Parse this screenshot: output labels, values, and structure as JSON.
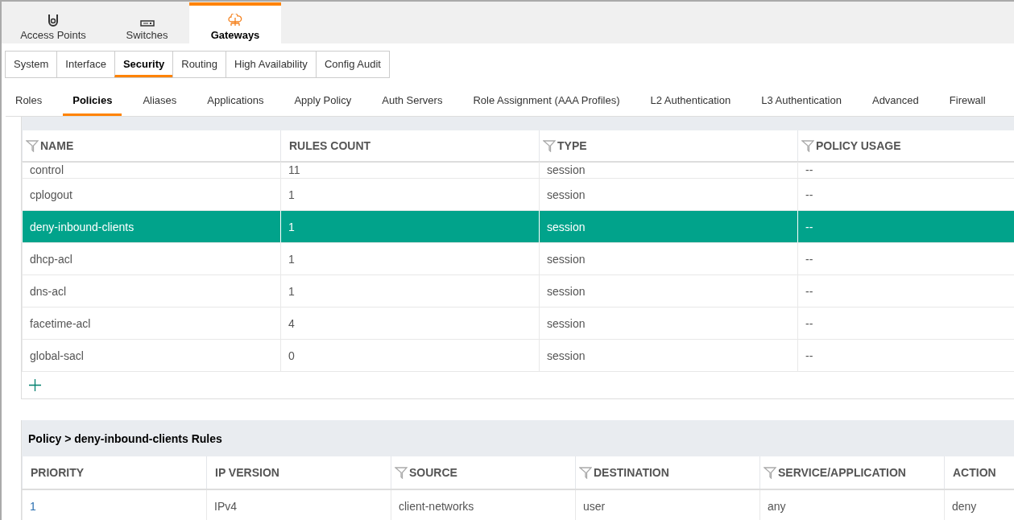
{
  "device_tabs": [
    {
      "label": "Access Points",
      "kind": "access-point",
      "selected": false
    },
    {
      "label": "Switches",
      "kind": "switch",
      "selected": false
    },
    {
      "label": "Gateways",
      "kind": "gateway",
      "selected": true
    }
  ],
  "section_tabs": [
    {
      "label": "System",
      "selected": false
    },
    {
      "label": "Interface",
      "selected": false
    },
    {
      "label": "Security",
      "selected": true
    },
    {
      "label": "Routing",
      "selected": false
    },
    {
      "label": "High Availability",
      "selected": false
    },
    {
      "label": "Config Audit",
      "selected": false
    }
  ],
  "security_tabs": [
    {
      "label": "Roles",
      "selected": false
    },
    {
      "label": "Policies",
      "selected": true
    },
    {
      "label": "Aliases",
      "selected": false
    },
    {
      "label": "Applications",
      "selected": false
    },
    {
      "label": "Apply Policy",
      "selected": false
    },
    {
      "label": "Auth Servers",
      "selected": false
    },
    {
      "label": "Role Assignment (AAA Profiles)",
      "selected": false
    },
    {
      "label": "L2 Authentication",
      "selected": false
    },
    {
      "label": "L3 Authentication",
      "selected": false
    },
    {
      "label": "Advanced",
      "selected": false
    },
    {
      "label": "Firewall",
      "selected": false
    }
  ],
  "policies_table": {
    "columns": [
      {
        "label": "NAME",
        "filter": true
      },
      {
        "label": "RULES COUNT",
        "filter": false
      },
      {
        "label": "TYPE",
        "filter": true
      },
      {
        "label": "POLICY USAGE",
        "filter": true
      }
    ],
    "rows": [
      {
        "cells": [
          "control",
          "11",
          "session",
          "--"
        ],
        "selected": false,
        "partial": true
      },
      {
        "cells": [
          "cplogout",
          "1",
          "session",
          "--"
        ],
        "selected": false,
        "partial": false
      },
      {
        "cells": [
          "deny-inbound-clients",
          "1",
          "session",
          "--"
        ],
        "selected": true,
        "partial": false
      },
      {
        "cells": [
          "dhcp-acl",
          "1",
          "session",
          "--"
        ],
        "selected": false,
        "partial": false
      },
      {
        "cells": [
          "dns-acl",
          "1",
          "session",
          "--"
        ],
        "selected": false,
        "partial": false
      },
      {
        "cells": [
          "facetime-acl",
          "4",
          "session",
          "--"
        ],
        "selected": false,
        "partial": false
      },
      {
        "cells": [
          "global-sacl",
          "0",
          "session",
          "--"
        ],
        "selected": false,
        "partial": false
      }
    ]
  },
  "rules_panel": {
    "title": "Policy > deny-inbound-clients Rules",
    "columns": [
      {
        "label": "PRIORITY",
        "filter": false
      },
      {
        "label": "IP VERSION",
        "filter": false
      },
      {
        "label": "SOURCE",
        "filter": true
      },
      {
        "label": "DESTINATION",
        "filter": true
      },
      {
        "label": "SERVICE/APPLICATION",
        "filter": true
      },
      {
        "label": "ACTION",
        "filter": false
      }
    ],
    "rows": [
      {
        "cells": [
          "1",
          "IPv4",
          "client-networks",
          "user",
          "any",
          "deny"
        ]
      }
    ]
  }
}
